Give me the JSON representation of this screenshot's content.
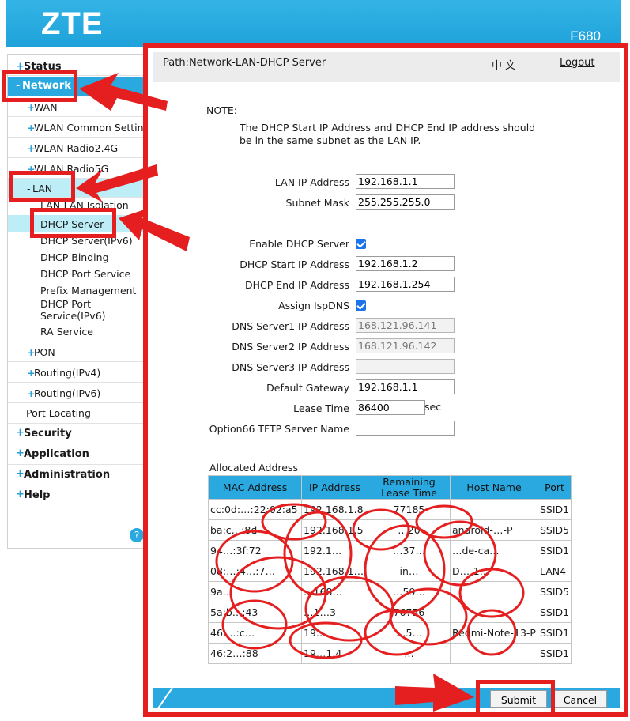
{
  "header": {
    "brand": "ZTE",
    "model": "F680"
  },
  "sidebar": {
    "items": [
      {
        "label": "Status",
        "prefix": "+",
        "level": "top"
      },
      {
        "label": "Network",
        "prefix": "-",
        "level": "top",
        "active": true
      },
      {
        "label": "WAN",
        "prefix": "+",
        "level": "sub"
      },
      {
        "label": "WLAN Common Settings",
        "prefix": "+",
        "level": "sub"
      },
      {
        "label": "WLAN Radio2.4G",
        "prefix": "+",
        "level": "sub"
      },
      {
        "label": "WLAN Radio5G",
        "prefix": "+",
        "level": "sub"
      },
      {
        "label": "LAN",
        "prefix": "-",
        "level": "sub",
        "active": true
      },
      {
        "label": "LAN-LAN Isolation",
        "level": "leaf"
      },
      {
        "label": "DHCP Server",
        "level": "leaf",
        "active": true
      },
      {
        "label": "DHCP Server(IPv6)",
        "level": "leaf"
      },
      {
        "label": "DHCP Binding",
        "level": "leaf"
      },
      {
        "label": "DHCP Port Service",
        "level": "leaf"
      },
      {
        "label": "Prefix Management",
        "level": "leaf"
      },
      {
        "label": "DHCP Port Service(IPv6)",
        "level": "leaf"
      },
      {
        "label": "RA Service",
        "level": "leaf"
      },
      {
        "label": "PON",
        "prefix": "+",
        "level": "sub"
      },
      {
        "label": "Routing(IPv4)",
        "prefix": "+",
        "level": "sub"
      },
      {
        "label": "Routing(IPv6)",
        "prefix": "+",
        "level": "sub"
      },
      {
        "label": "Port Locating",
        "level": "sub"
      },
      {
        "label": "Security",
        "prefix": "+",
        "level": "top"
      },
      {
        "label": "Application",
        "prefix": "+",
        "level": "top"
      },
      {
        "label": "Administration",
        "prefix": "+",
        "level": "top"
      },
      {
        "label": "Help",
        "prefix": "+",
        "level": "top"
      }
    ],
    "help_badge": "?"
  },
  "pathbar": {
    "path": "Path:Network-LAN-DHCP Server",
    "lang": "中 文",
    "logout": "Logout"
  },
  "note": {
    "label": "NOTE:",
    "text": "The DHCP Start IP Address and DHCP End IP address should be in the same subnet as the LAN IP."
  },
  "form": {
    "lan_ip_label": "LAN IP Address",
    "lan_ip": "192.168.1.1",
    "subnet_label": "Subnet Mask",
    "subnet": "255.255.255.0",
    "enable_dhcp_label": "Enable DHCP Server",
    "enable_dhcp": true,
    "start_ip_label": "DHCP Start IP Address",
    "start_ip": "192.168.1.2",
    "end_ip_label": "DHCP End IP Address",
    "end_ip": "192.168.1.254",
    "assign_isp_dns_label": "Assign IspDNS",
    "assign_isp_dns": true,
    "dns1_label": "DNS Server1 IP Address",
    "dns1": "168.121.96.141",
    "dns2_label": "DNS Server2 IP Address",
    "dns2": "168.121.96.142",
    "dns3_label": "DNS Server3 IP Address",
    "dns3": "",
    "gateway_label": "Default Gateway",
    "gateway": "192.168.1.1",
    "lease_label": "Lease Time",
    "lease": "86400",
    "lease_unit": "sec",
    "option66_label": "Option66 TFTP Server Name",
    "option66": ""
  },
  "allocated": {
    "title": "Allocated Address",
    "columns": [
      "MAC Address",
      "IP Address",
      "Remaining Lease Time",
      "Host Name",
      "Port"
    ],
    "rows": [
      [
        "cc:0d:…:22:02:a5",
        "192.168.1.8",
        "77185",
        "",
        "SSID1"
      ],
      [
        "ba:c…:8d",
        "192.168.1.5",
        "…20",
        "android-…-P",
        "SSID5"
      ],
      [
        "94…:3f:72",
        "192.1…",
        "…37…",
        "…de-ca…",
        "SSID1"
      ],
      [
        "08:…:4…:7…",
        "192.168.1…",
        "in…",
        "D…-1…",
        "LAN4"
      ],
      [
        "9a…",
        "…168…",
        "…59…",
        "",
        "SSID5"
      ],
      [
        "5a:b…:43",
        "…1…3",
        "76756",
        "",
        "SSID1"
      ],
      [
        "46:…:c…",
        "19…",
        "…5…",
        "Redmi-Note-13-P",
        "SSID1"
      ],
      [
        "46:2…:88",
        "19…1.4",
        "…",
        "",
        "SSID1"
      ]
    ]
  },
  "buttons": {
    "submit": "Submit",
    "cancel": "Cancel"
  },
  "colors": {
    "accent": "#29a9e0",
    "annotation": "#e51f1f"
  }
}
